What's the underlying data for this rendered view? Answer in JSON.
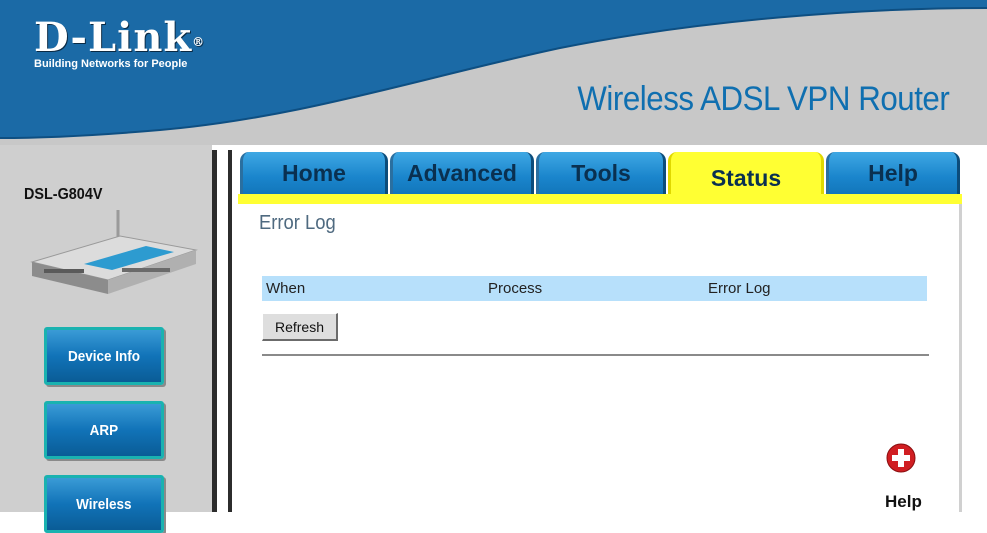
{
  "header": {
    "brand": "D-Link",
    "trademark": "®",
    "tagline": "Building Networks for People",
    "product_title": "Wireless ADSL VPN Router"
  },
  "sidebar": {
    "model": "DSL-G804V",
    "buttons": [
      {
        "label": "Device Info"
      },
      {
        "label": "ARP"
      },
      {
        "label": "Wireless"
      }
    ]
  },
  "tabs": [
    {
      "label": "Home",
      "active": false
    },
    {
      "label": "Advanced",
      "active": false
    },
    {
      "label": "Tools",
      "active": false
    },
    {
      "label": "Status",
      "active": true
    },
    {
      "label": "Help",
      "active": false
    }
  ],
  "main": {
    "title": "Error Log",
    "table": {
      "columns": [
        "When",
        "Process",
        "Error Log"
      ],
      "rows": []
    },
    "refresh_label": "Refresh",
    "help_label": "Help"
  },
  "colors": {
    "header_blue": "#1b6aa6",
    "tab_blue": "#1a85cc",
    "active_tab": "#ffff33",
    "table_header": "#b7e0fb",
    "product_title": "#0f6fb0"
  }
}
